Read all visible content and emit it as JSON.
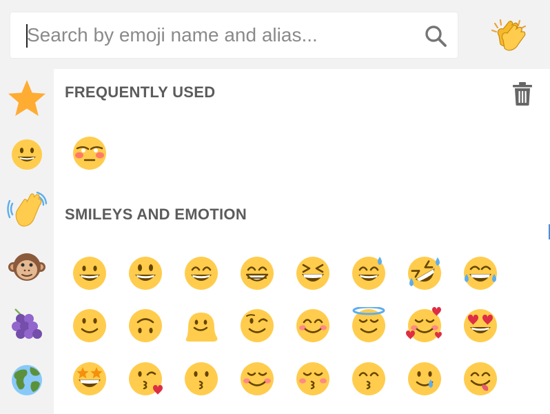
{
  "search": {
    "placeholder": "Search by emoji name and alias..."
  },
  "skin_tone_button": {
    "icon": "clapping-hands-icon"
  },
  "categories": [
    {
      "name": "frequently-used",
      "icon": "star-icon"
    },
    {
      "name": "smileys-and-emotion",
      "icon": "grinning-face-icon"
    },
    {
      "name": "people-and-body",
      "icon": "waving-hand-icon"
    },
    {
      "name": "animals-and-nature",
      "icon": "monkey-face-icon"
    },
    {
      "name": "food-and-drink",
      "icon": "grapes-icon"
    },
    {
      "name": "travel-and-places",
      "icon": "globe-icon"
    }
  ],
  "sections": {
    "frequently_used": {
      "title": "FREQUENTLY USED",
      "clear_icon": "trash-icon",
      "emojis": [
        "flushed-blushing-face-icon"
      ]
    },
    "smileys": {
      "title": "SMILEYS AND EMOTION",
      "emojis": [
        "grinning-face-icon",
        "smiley-icon",
        "smile-icon",
        "grin-icon",
        "laughing-icon",
        "sweat-smile-icon",
        "rolling-on-floor-laughing-icon",
        "joy-icon",
        "slightly-smiling-face-icon",
        "upside-down-face-icon",
        "melting-face-icon",
        "wink-icon",
        "blush-icon",
        "innocent-icon",
        "smiling-face-with-hearts-icon",
        "heart-eyes-icon",
        "star-struck-icon",
        "kissing-heart-icon",
        "kissing-icon",
        "relaxed-icon",
        "kissing-closed-eyes-icon",
        "kissing-smiling-eyes-icon",
        "smiling-face-with-tear-icon",
        "yum-icon"
      ]
    }
  },
  "colors": {
    "face": "#FFCC4D",
    "feature": "#664500",
    "heart": "#DD2E44",
    "tear": "#5DADEC",
    "blush": "#FF7892",
    "star": "#FFAC33",
    "panel_bg": "#F2F2F2",
    "section_title": "#5B5B5B"
  }
}
